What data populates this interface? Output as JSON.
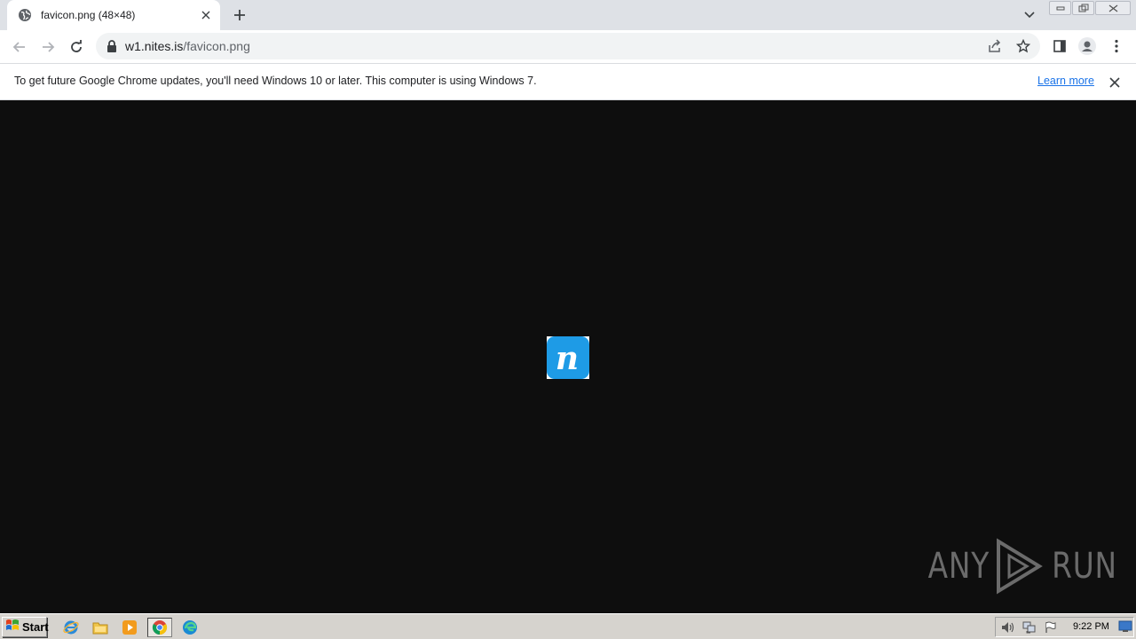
{
  "tab": {
    "title": "favicon.png (48×48)",
    "favicon": "globe-icon"
  },
  "address_bar": {
    "host": "w1.nites.is",
    "path": "/favicon.png"
  },
  "infobar": {
    "message": "To get future Google Chrome updates, you'll need Windows 10 or later. This computer is using Windows 7.",
    "link_label": "Learn more"
  },
  "image": {
    "letter": "n",
    "color": "#1e9be6"
  },
  "watermark": {
    "text_left": "ANY",
    "text_right": "RUN"
  },
  "taskbar": {
    "start_label": "Start",
    "apps": [
      "internet-explorer-icon",
      "file-explorer-icon",
      "media-player-icon",
      "chrome-icon",
      "edge-icon"
    ],
    "clock": "9:22 PM"
  }
}
